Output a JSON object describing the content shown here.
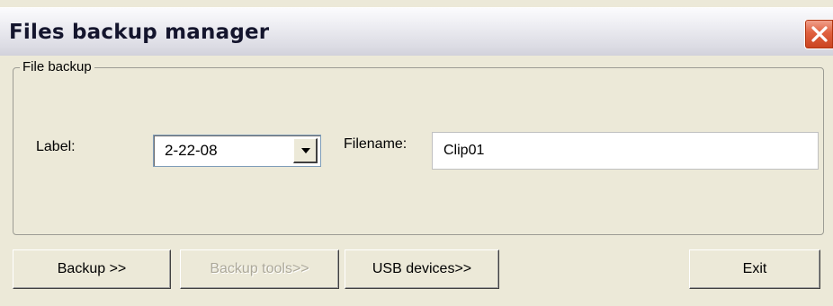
{
  "window": {
    "title": "Files backup manager",
    "close_icon": "close-icon"
  },
  "group": {
    "legend": "File backup"
  },
  "form": {
    "label_caption": "Label:",
    "label_value": "2-22-08",
    "dropdown_icon": "chevron-down-icon",
    "filename_caption": "Filename:",
    "filename_value": "Clip01"
  },
  "buttons": {
    "backup": "Backup >>",
    "backup_tools": "Backup tools>>",
    "backup_tools_enabled": false,
    "usb_devices": "USB devices>>",
    "exit": "Exit"
  },
  "colors": {
    "close_button": "#e0613f",
    "window_background": "#ece9d8",
    "disabled_text": "#aca899"
  }
}
